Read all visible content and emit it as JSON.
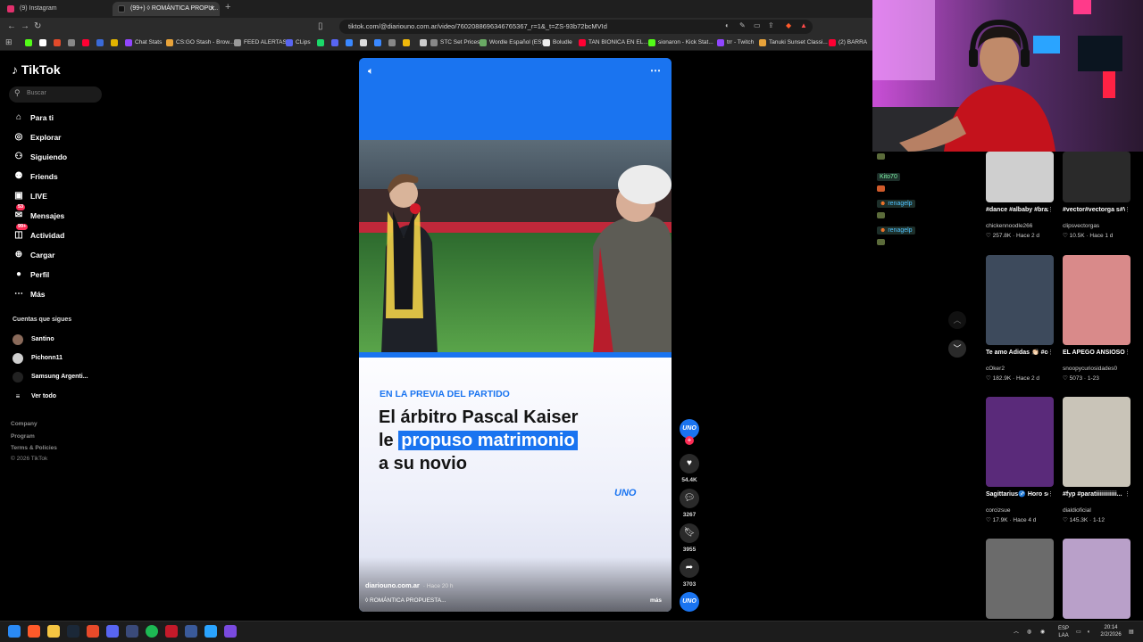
{
  "browser": {
    "tabs": [
      {
        "title": "(9) Instagram",
        "active": false
      },
      {
        "title": "(99+) ◊ ROMÁNTICA PROPU...",
        "active": true
      }
    ],
    "url": "tiktok.com/@diariouno.com.ar/video/7602088696346765367_r=1&_t=ZS-93b72bcMVId",
    "bookmarks": [
      "",
      "",
      "",
      "",
      "",
      "",
      "Chat Stats",
      "CS:GO Stash - Brow...",
      "FEED ALERTAS",
      "CLips",
      "",
      "",
      "",
      "",
      "",
      "STC Set Prices",
      "Wordle Español (ES)",
      "Boludle",
      "TAN BIONICA EN EL...",
      "sionaron - Kick Stat...",
      "trr - Twitch",
      "Tanuki Sunset Classi...",
      "(2) BARRA"
    ]
  },
  "sidebar": {
    "logo": "TikTok",
    "search_placeholder": "Buscar",
    "nav": [
      {
        "label": "Para ti",
        "icon": "home-icon",
        "glyph": "⌂",
        "badge": ""
      },
      {
        "label": "Explorar",
        "icon": "compass-icon",
        "glyph": "◎",
        "badge": ""
      },
      {
        "label": "Siguiendo",
        "icon": "following-icon",
        "glyph": "⚇",
        "badge": ""
      },
      {
        "label": "Friends",
        "icon": "friends-icon",
        "glyph": "⚉",
        "badge": ""
      },
      {
        "label": "LIVE",
        "icon": "live-icon",
        "glyph": "▣",
        "badge": ""
      },
      {
        "label": "Mensajes",
        "icon": "messages-icon",
        "glyph": "✉",
        "badge": "53"
      },
      {
        "label": "Actividad",
        "icon": "activity-icon",
        "glyph": "◫",
        "badge": "99+"
      },
      {
        "label": "Cargar",
        "icon": "upload-icon",
        "glyph": "⊕",
        "badge": ""
      },
      {
        "label": "Perfil",
        "icon": "profile-icon",
        "glyph": "●",
        "badge": ""
      },
      {
        "label": "Más",
        "icon": "more-icon",
        "glyph": "⋯",
        "badge": ""
      }
    ],
    "following_heading": "Cuentas que sigues",
    "following": [
      {
        "name": "Santino",
        "verified": false,
        "color": "#8a6a5a"
      },
      {
        "name": "Pichonn11",
        "verified": false,
        "color": "#cfcfcf"
      },
      {
        "name": "Samsung Argenti...",
        "verified": true,
        "color": "#222222"
      },
      {
        "name": "Ver todo",
        "verified": false,
        "color": "#000000"
      }
    ],
    "footer": [
      "Company",
      "Program",
      "Terms & Policies",
      "© 2026 TikTok"
    ]
  },
  "video": {
    "kicker": "EN LA PREVIA DEL PARTIDO",
    "headline_line1": "El árbitro Pascal Kaiser",
    "headline_line2_a": "le ",
    "headline_line2_b": "propuso matrimonio",
    "headline_line3": "a su novio",
    "brand": "UNO",
    "author": "diariouno.com.ar",
    "time": "· Hace 20 h",
    "caption": "◊ ROMÁNTICA PROPUESTA...",
    "more": "más",
    "accent": "#1a74f0"
  },
  "actions": {
    "avatar_label": "UNO",
    "likes": "54.4K",
    "comments": "3267",
    "saves": "3955",
    "shares": "3703",
    "sound_label": "UNO"
  },
  "chat": [
    {
      "user": "",
      "text": ""
    },
    {
      "user": "Kito70",
      "text": ""
    },
    {
      "user": "renagelp",
      "text": ""
    },
    {
      "user": "renagelp",
      "text": ""
    }
  ],
  "recommended": [
    {
      "title": "#dance #albaby #brazil",
      "author": "chickennoodle266",
      "stats": "♡ 257.8K · Hace 2 d",
      "bg": "#cfcfcf"
    },
    {
      "title": "#vector#vectorga s#Viral#foryouff...",
      "author": "clipsvectorgas",
      "stats": "♡ 10.5K · Hace 1 d",
      "bg": "#2a2a2a"
    },
    {
      "title": "Te amo Adidas 👏🏻 #coker",
      "author": "cOker2",
      "stats": "♡ 182.9K · Hace 2 d",
      "bg": "#3d4a5c"
    },
    {
      "title": "EL APEGO ANSIOSO #tik...",
      "author": "snoopycuriosidades0",
      "stats": "♡ 5073 · 1-23",
      "bg": "#d98a8a"
    },
    {
      "title": "Sagittarius♐ Horo scope #sagittari...",
      "author": "corcizsue",
      "stats": "♡ 17.9K · Hace 4 d",
      "bg": "#5a2a7a"
    },
    {
      "title": "#fyp #paratiiiiiiiiiiii...",
      "author": "dialdioficial",
      "stats": "♡ 145.3K · 1-12",
      "bg": "#c9c4b8"
    },
    {
      "title": "",
      "author": "",
      "stats": "",
      "bg": "#6b6b6b"
    },
    {
      "title": "",
      "author": "",
      "stats": "",
      "bg": "#b9a0c9"
    }
  ],
  "taskbar": {
    "lang": "ESP\nLAA",
    "time": "20:14",
    "date": "2/2/2026"
  }
}
